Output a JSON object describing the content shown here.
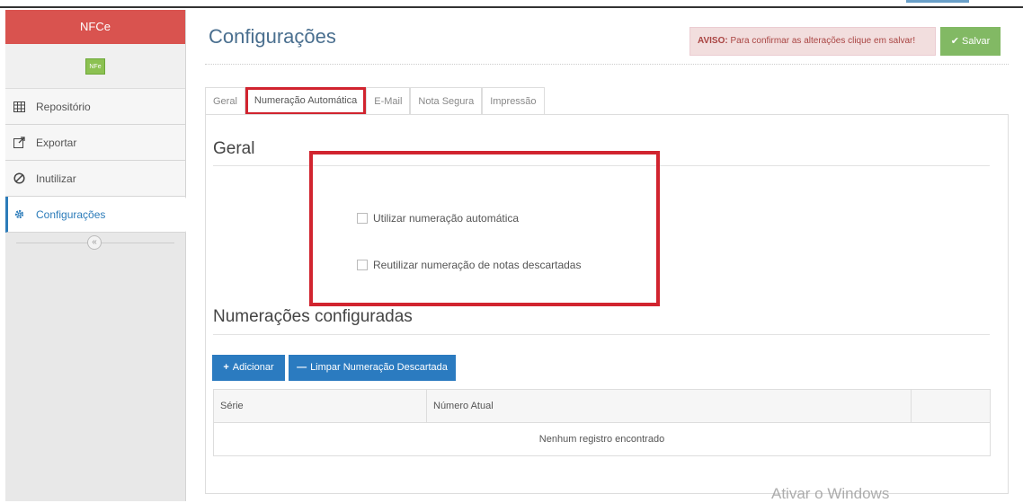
{
  "sidebar": {
    "brand": "NFCe",
    "badge": "NFe",
    "items": [
      {
        "label": "Repositório",
        "icon": "grid-table-icon"
      },
      {
        "label": "Exportar",
        "icon": "external-link-icon"
      },
      {
        "label": "Inutilizar",
        "icon": "ban-icon"
      },
      {
        "label": "Configurações",
        "icon": "gear-icon"
      }
    ],
    "collapse_glyph": "«"
  },
  "header": {
    "title": "Configurações",
    "aviso_prefix": "AVISO:",
    "aviso_text": " Para confirmar as alterações clique em salvar!",
    "save_label": "Salvar"
  },
  "tabs": [
    {
      "label": "Geral"
    },
    {
      "label": "Numeração Automática"
    },
    {
      "label": "E-Mail"
    },
    {
      "label": "Nota Segura"
    },
    {
      "label": "Impressão"
    }
  ],
  "geral": {
    "title": "Geral",
    "options": [
      {
        "label": "Utilizar numeração automática",
        "checked": false
      },
      {
        "label": "Reutilizar numeração de notas descartadas",
        "checked": false
      }
    ]
  },
  "numeracoes": {
    "title": "Numerações configuradas",
    "add_label": "Adicionar",
    "limpar_label": "Limpar Numeração Descartada",
    "columns": [
      "Série",
      "Número Atual",
      ""
    ],
    "empty_text": "Nenhum registro encontrado"
  },
  "watermark": "Ativar o Windows",
  "colors": {
    "brand": "#d9534f",
    "accent": "#2b7bc0",
    "save": "#82b964",
    "highlight": "#d1242f"
  }
}
